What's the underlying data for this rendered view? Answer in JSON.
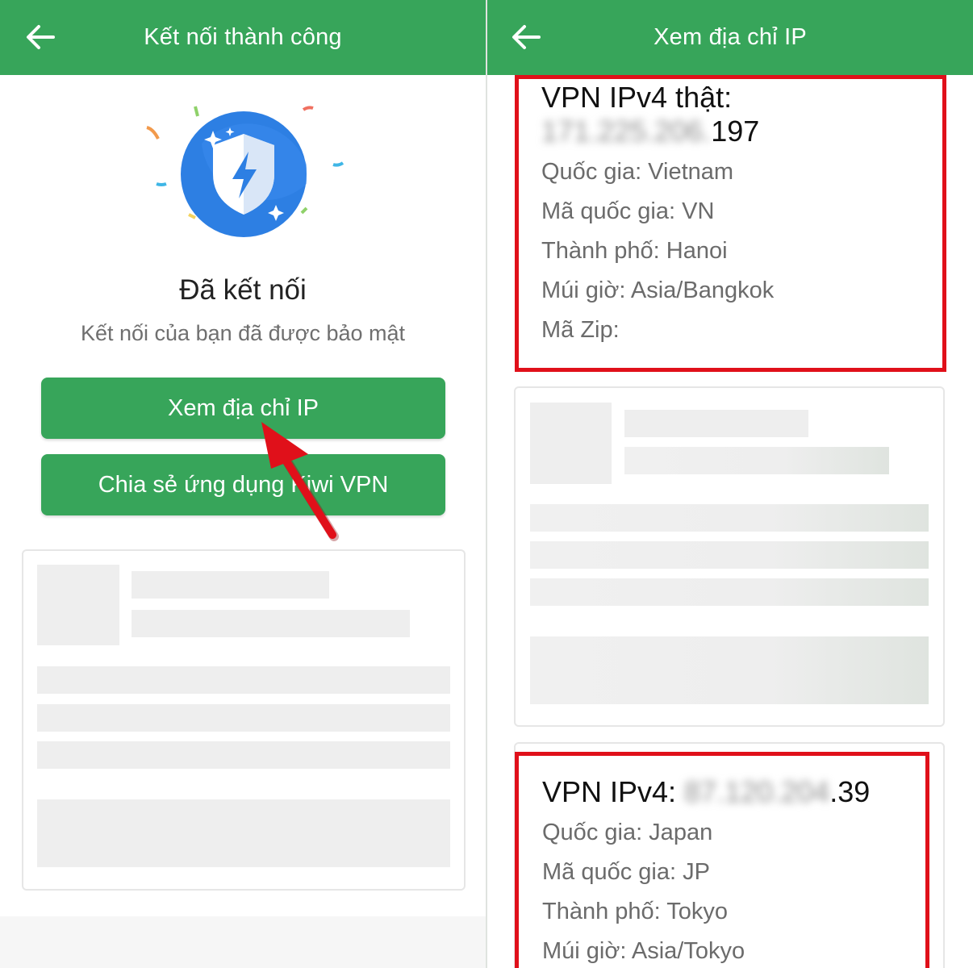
{
  "left": {
    "appbar": {
      "title": "Kết nối thành công",
      "back_icon": "arrow-left-icon"
    },
    "status": {
      "title": "Đã kết nối",
      "subtitle": "Kết nối của bạn đã được bảo mật"
    },
    "buttons": {
      "view_ip": "Xem địa chỉ IP",
      "share": "Chia sẻ ứng dụng Kiwi VPN"
    },
    "colors": {
      "primary": "#37a55a",
      "shield": "#2d7fe3",
      "annotation": "#e0101a"
    }
  },
  "right": {
    "appbar": {
      "title": "Xem địa chỉ IP",
      "back_icon": "arrow-left-icon"
    },
    "real_ip": {
      "label": "VPN IPv4 thật:",
      "ip_hidden": "171.225.206.",
      "ip_visible": "197",
      "country": "Quốc gia: Vietnam",
      "country_code": "Mã quốc gia: VN",
      "city": "Thành phố: Hanoi",
      "timezone": "Múi giờ: Asia/Bangkok",
      "zip": "Mã Zip:"
    },
    "vpn_ip": {
      "label": "VPN IPv4:",
      "ip_hidden": "87.120.204",
      "ip_visible": ".39",
      "country": "Quốc gia: Japan",
      "country_code": "Mã quốc gia: JP",
      "city": "Thành phố: Tokyo",
      "timezone": "Múi giờ: Asia/Tokyo"
    }
  }
}
